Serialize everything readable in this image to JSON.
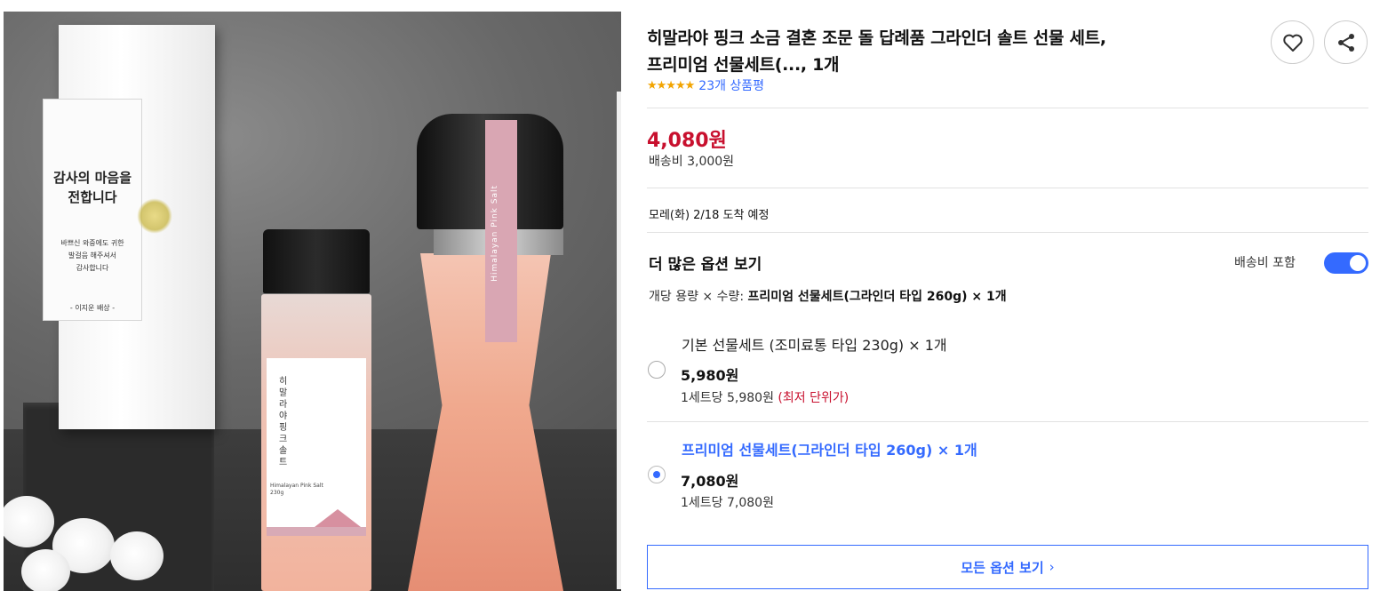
{
  "product": {
    "title_line1": "히말라야 핑크 소금 결혼 조문 돌 답례품 그라인더 솔트 선물 세트,",
    "title_line2": "프리미엄 선물세트(..., 1개",
    "rating_stars": "★★★★★",
    "rating_value": 5,
    "review_link": "23개 상품평",
    "price": "4,080원",
    "shipping": "배송비 3,000원",
    "delivery_date": "모레(화) 2/18",
    "delivery_suffix": " 도착 예정"
  },
  "image": {
    "gift_box_line1": "감사의 마음을",
    "gift_box_line2": "전합니다",
    "gift_box_sub1": "바쁘신 와중에도 귀한",
    "gift_box_sub2": "발걸음 해주셔서",
    "gift_box_sub3": "감사합니다",
    "gift_box_sign": "- 이지운 배상 -",
    "shaker_korean": "히말라야 핑크솔트",
    "shaker_english": "Himalayan Pink Salt",
    "shaker_weight": "230g",
    "grinder_band": "Himalayan Pink Salt"
  },
  "options": {
    "heading": "더 많은 옵션 보기",
    "toggle_label": "배송비 포함",
    "toggle_on": true,
    "selection_prefix": "개당 용량 × 수량: ",
    "selection_value": "프리미엄 선물세트(그라인더 타입 260g) × 1개",
    "items": [
      {
        "name": "기본 선물세트 (조미료통 타입 230g) × 1개",
        "price": "5,980원",
        "unit_price": "1세트당 5,980원",
        "badge": "(최저 단위가)",
        "selected": false
      },
      {
        "name": "프리미엄 선물세트(그라인더 타입 260g) × 1개",
        "price": "7,080원",
        "unit_price": "1세트당 7,080원",
        "badge": "",
        "selected": true
      }
    ],
    "all_options_button": "모든 옵션 보기"
  },
  "colors": {
    "accent": "#346aff",
    "price": "#c8102e",
    "star": "#f2a400"
  },
  "icons": [
    "heart-icon",
    "share-icon",
    "chevron-right-icon"
  ]
}
